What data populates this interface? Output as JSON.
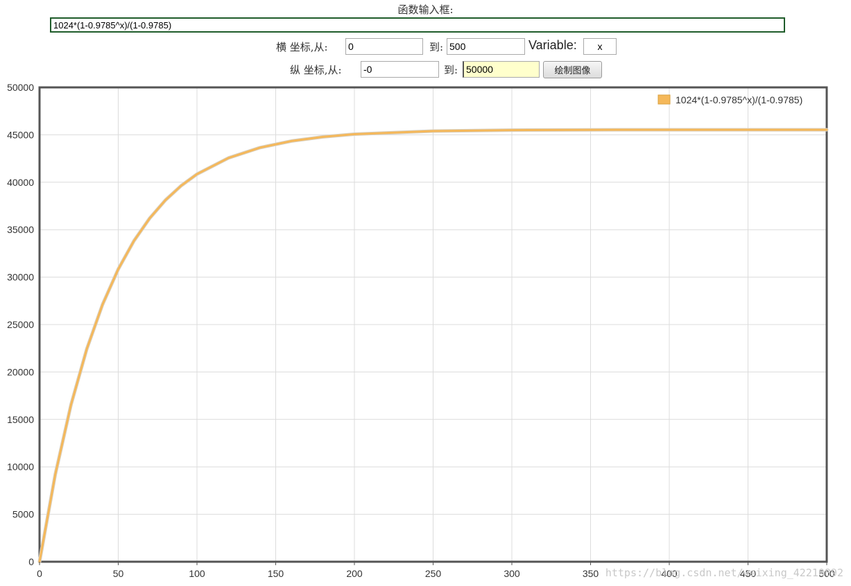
{
  "form": {
    "title": "函数输入框:",
    "function_value": "1024*(1-0.9785^x)/(1-0.9785)",
    "x_range_label": "横 坐标,从:",
    "x_from": "0",
    "x_to_label": "到:",
    "x_to": "500",
    "variable_label": "Variable:",
    "variable_value": "x",
    "y_range_label": "纵 坐标,从:",
    "y_from": "-0",
    "y_to_label": "到:",
    "y_to": "50000",
    "draw_button_label": "绘制图像"
  },
  "chart_data": {
    "type": "line",
    "function": "1024*(1-0.9785^x)/(1-0.9785)",
    "xlim": [
      0,
      500
    ],
    "ylim": [
      0,
      50000
    ],
    "x_ticks": [
      0,
      50,
      100,
      150,
      200,
      250,
      300,
      350,
      400,
      450,
      500
    ],
    "y_ticks": [
      0,
      5000,
      10000,
      15000,
      20000,
      25000,
      30000,
      35000,
      40000,
      45000,
      50000
    ],
    "grid": true,
    "legend_position": "top-right",
    "series": [
      {
        "name": "1024*(1-0.9785^x)/(1-0.9785)",
        "color": "#f5b85a",
        "x": [
          0,
          10,
          20,
          30,
          40,
          50,
          60,
          70,
          80,
          90,
          100,
          120,
          140,
          160,
          180,
          200,
          250,
          300,
          350,
          400,
          450,
          500
        ],
        "y": [
          0,
          9203,
          16551,
          22418,
          27103,
          30844,
          33831,
          36216,
          38120,
          39641,
          40855,
          42560,
          43649,
          44342,
          44784,
          45065,
          45398,
          45496,
          45525,
          45533,
          45535,
          45535
        ]
      }
    ]
  },
  "watermark": "https://blog.csdn.net/weixing_42210892"
}
